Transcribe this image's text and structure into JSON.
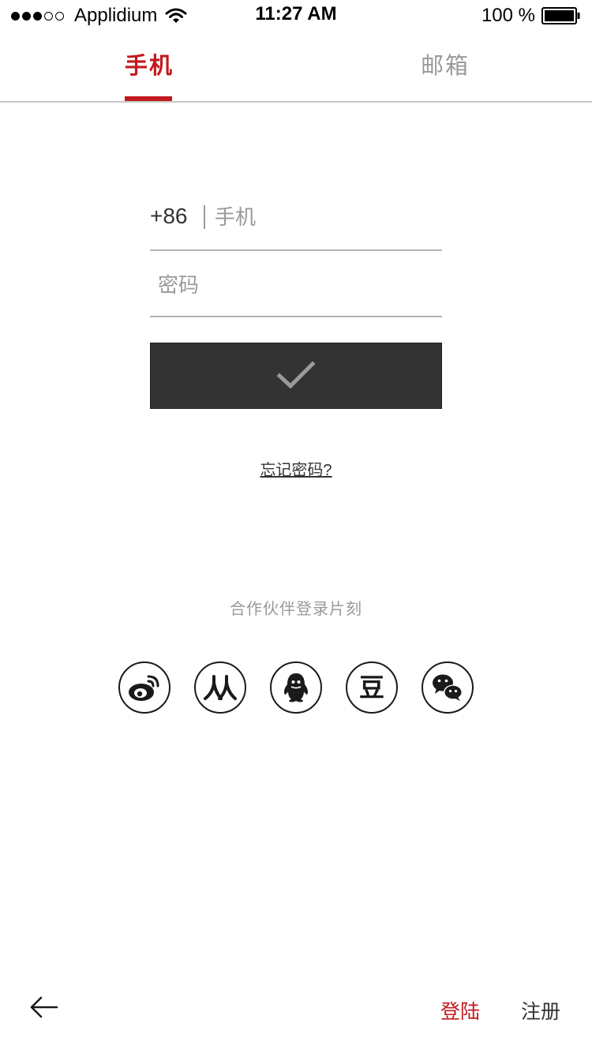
{
  "status_bar": {
    "signal": {
      "filled": 3,
      "total": 5
    },
    "carrier": "Applidium",
    "time": "11:27 AM",
    "battery": "100 %",
    "battery_level": 1.0
  },
  "tabs": [
    {
      "label": "手机",
      "active": true
    },
    {
      "label": "邮箱",
      "active": false
    }
  ],
  "form": {
    "country_code": "+86",
    "phone_placeholder": "手机",
    "password_placeholder": "密码",
    "submit_icon": "check-icon"
  },
  "forgot_password": "忘记密码?",
  "partner_label": "合作伙伴登录片刻",
  "social": [
    {
      "name": "weibo",
      "icon": "weibo-icon"
    },
    {
      "name": "renren",
      "icon": "renren-icon"
    },
    {
      "name": "qq",
      "icon": "qq-icon"
    },
    {
      "name": "douban",
      "icon": "douban-icon",
      "glyph": "豆"
    },
    {
      "name": "wechat",
      "icon": "wechat-icon"
    }
  ],
  "bottom_bar": {
    "back_icon": "back-arrow-icon",
    "login": "登陆",
    "register": "注册"
  },
  "colors": {
    "accent": "#c2191f",
    "dark_button": "#333333",
    "muted_text": "#999999",
    "divider": "#b3b3b3"
  }
}
